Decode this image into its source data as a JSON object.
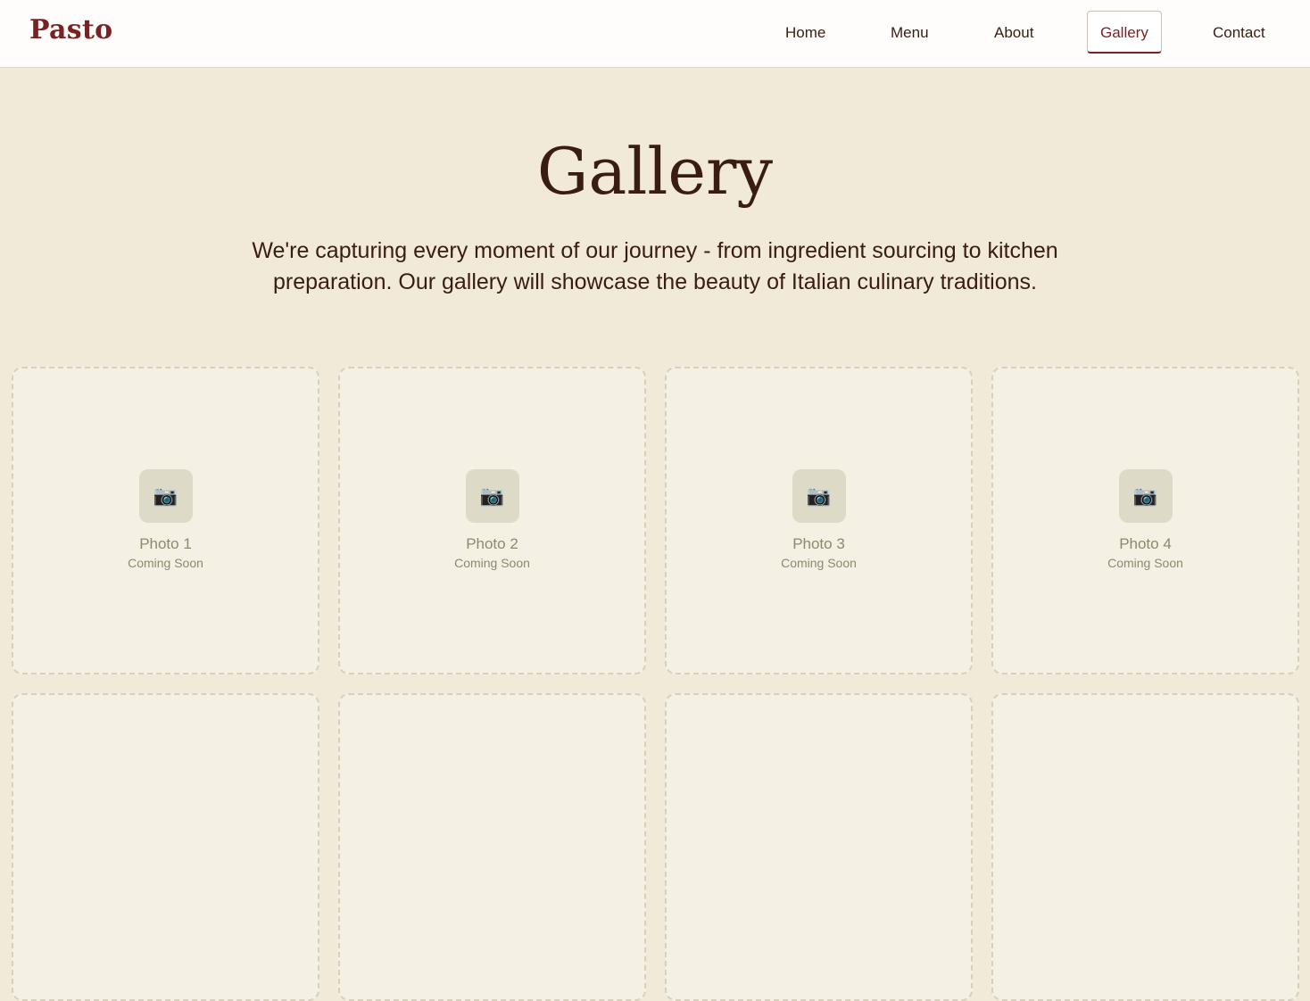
{
  "brand": {
    "logo_text": "Pasto",
    "primary_color": "#7a2222",
    "text_color": "#3a1d12",
    "background": "#f1ead9"
  },
  "nav": {
    "items": [
      {
        "label": "Home",
        "active": false
      },
      {
        "label": "Menu",
        "active": false
      },
      {
        "label": "About",
        "active": false
      },
      {
        "label": "Gallery",
        "active": true
      },
      {
        "label": "Contact",
        "active": false
      }
    ]
  },
  "hero": {
    "title": "Gallery",
    "description": "We're capturing every moment of our journey - from ingredient sourcing to kitchen preparation. Our gallery will showcase the beauty of Italian culinary traditions."
  },
  "gallery": {
    "cards": [
      {
        "icon": "camera-icon",
        "title": "Photo 1",
        "subtitle": "Coming Soon"
      },
      {
        "icon": "camera-icon",
        "title": "Photo 2",
        "subtitle": "Coming Soon"
      },
      {
        "icon": "camera-icon",
        "title": "Photo 3",
        "subtitle": "Coming Soon"
      },
      {
        "icon": "camera-icon",
        "title": "Photo 4",
        "subtitle": "Coming Soon"
      },
      {
        "icon": "camera-icon",
        "title": "",
        "subtitle": ""
      },
      {
        "icon": "camera-icon",
        "title": "",
        "subtitle": ""
      },
      {
        "icon": "camera-icon",
        "title": "",
        "subtitle": ""
      },
      {
        "icon": "camera-icon",
        "title": "",
        "subtitle": ""
      }
    ]
  }
}
